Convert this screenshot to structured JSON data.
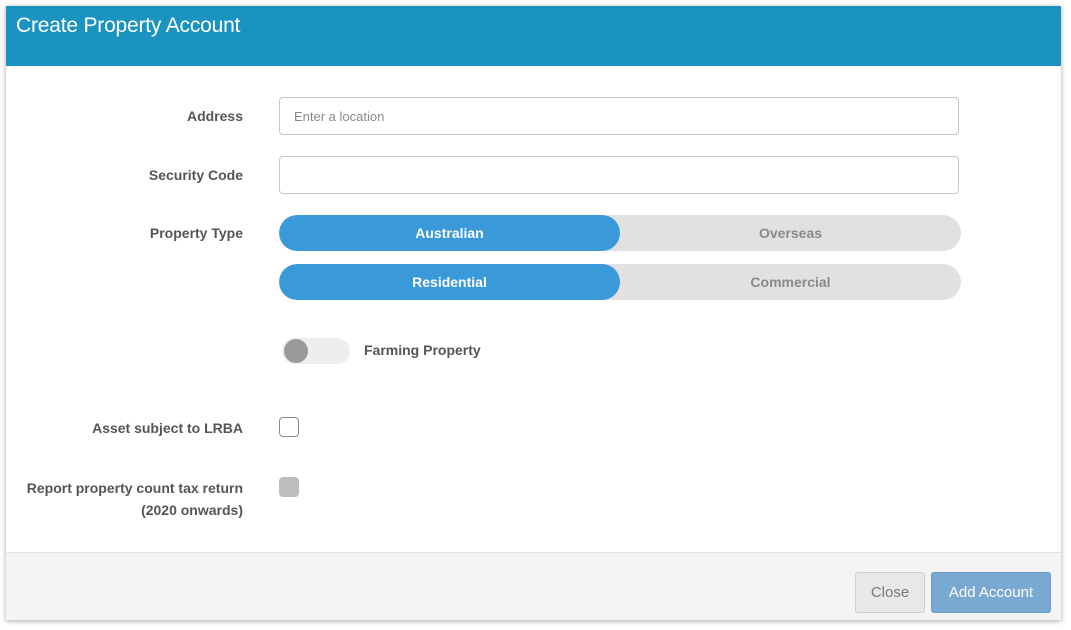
{
  "dialog": {
    "title": "Create Property Account"
  },
  "form": {
    "address": {
      "label": "Address",
      "placeholder": "Enter a location",
      "value": ""
    },
    "security_code": {
      "label": "Security Code",
      "value": ""
    },
    "property_type": {
      "label": "Property Type",
      "location_options": [
        "Australian",
        "Overseas"
      ],
      "location_selected": "Australian",
      "usage_options": [
        "Residential",
        "Commercial"
      ],
      "usage_selected": "Residential"
    },
    "farming": {
      "label": "Farming Property",
      "on": false
    },
    "lrba": {
      "label": "Asset subject to LRBA",
      "checked": false
    },
    "report_count": {
      "label_line1": "Report property count tax return",
      "label_line2": "(2020 onwards)",
      "checked": false,
      "disabled": true
    }
  },
  "footer": {
    "close_label": "Close",
    "add_label": "Add Account"
  },
  "colors": {
    "header": "#1a93c1",
    "segment_active": "#3a9ad9",
    "primary_button": "#79a8d1"
  }
}
